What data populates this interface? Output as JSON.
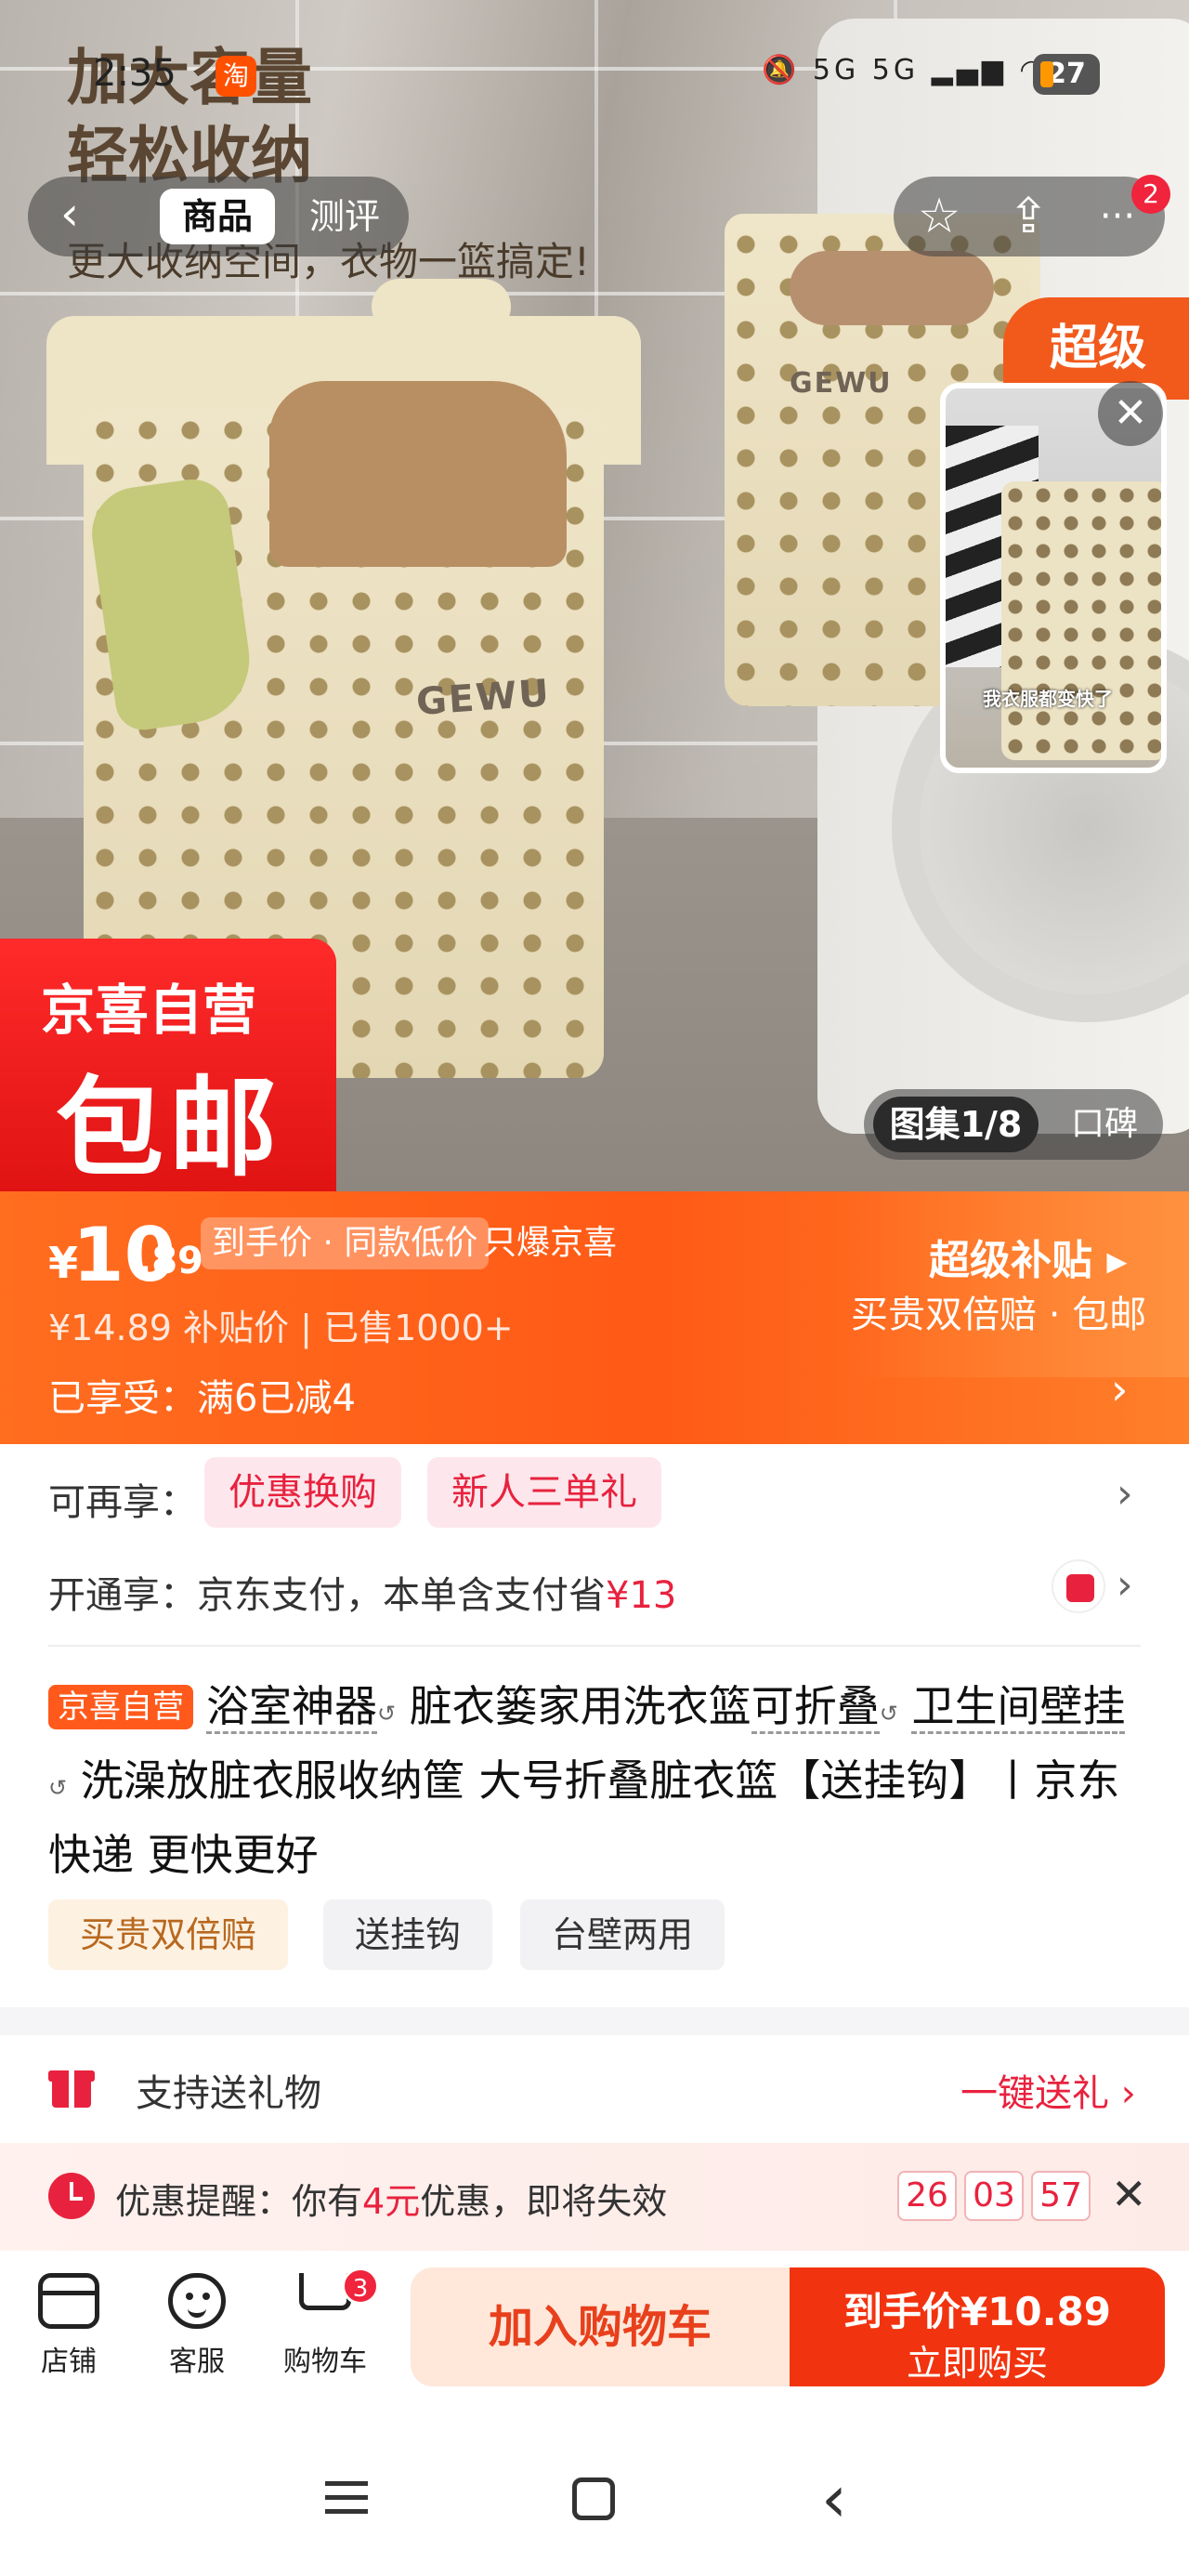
{
  "status_bar": {
    "time": "2:35",
    "app_icon": "淘",
    "network": "5G 5G",
    "battery": "27"
  },
  "hero": {
    "promo_line1": "加大容量",
    "promo_line2": "轻松收纳",
    "promo_sub": "更大收纳空间，衣物一篮搞定!",
    "brand": "GEWU",
    "super_ribbon": "超级",
    "video_caption": "我衣服都变快了",
    "badge_top": "京喜自营",
    "badge_bottom": "包邮",
    "gallery_active": "图集1/8",
    "gallery_other": "口碑"
  },
  "nav": {
    "back_icon": "‹",
    "tab_active": "商品",
    "tab_inactive": "测评",
    "star_icon": "☆",
    "share_icon": "⇪",
    "more_icon": "···",
    "message_badge": "2",
    "close_icon": "✕"
  },
  "price": {
    "currency": "¥",
    "integer": "10",
    "decimal": ".89",
    "tag": "到手价 · 同款低价",
    "tag_tail": "只爆京喜",
    "original": "¥14.89",
    "subsidy_price_label": "补贴价",
    "sold": "已售1000+",
    "enjoy": "已享受：满6已减4",
    "super_subsidy": "超级补贴 ▸",
    "super_sub_text": "买贵双倍赔 · 包邮"
  },
  "offers": {
    "label": "可再享：",
    "chips": [
      "优惠换购",
      "新人三单礼"
    ],
    "pay_label": "开通享：京东支付，本单含支付省",
    "pay_amount": "¥13"
  },
  "product": {
    "self_tag": "京喜自营",
    "title_seg1": "浴室神器",
    "title_seg2": "脏衣篓家用洗衣篮",
    "title_seg3": "可折叠",
    "title_seg4": "卫生间壁",
    "title_seg5": "挂",
    "title_seg6": "洗澡放脏衣服收纳筐 大号折叠脏衣篮【送挂钩】丨京东快递 更快更好",
    "tags": [
      "买贵双倍赔",
      "送挂钩",
      "台壁两用"
    ]
  },
  "gift": {
    "label": "支持送礼物",
    "action": "一键送礼 ›"
  },
  "reminder": {
    "prefix": "优惠提醒：你有",
    "amount": "4元",
    "suffix": "优惠，即将失效",
    "countdown": [
      "26",
      "03",
      "57"
    ]
  },
  "bottom_bar": {
    "shop": "店铺",
    "service": "客服",
    "cart": "购物车",
    "cart_count": "3",
    "add_cart": "加入购物车",
    "buy_top": "到手价¥10.89",
    "buy_bottom": "立即购买"
  }
}
